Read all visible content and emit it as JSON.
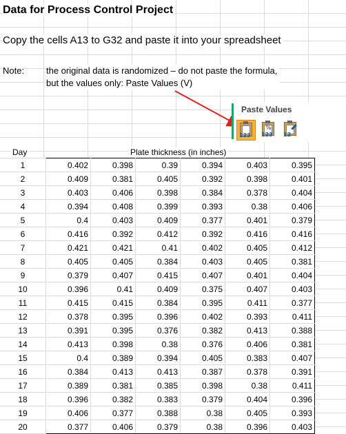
{
  "title": "Data for Process Control Project",
  "instruction": "Copy the cells A13 to G32 and paste it into your spreadsheet",
  "note": {
    "label": "Note:",
    "line1": "the original data is randomized – do not paste the formula,",
    "line2": "but the values only:  Paste Values (V)"
  },
  "paste_values": {
    "title": "Paste Values",
    "options": [
      {
        "icon": "paste-values-123-icon",
        "label": "123",
        "selected": true
      },
      {
        "icon": "paste-values-number-format-icon",
        "label": "123"
      },
      {
        "icon": "paste-values-source-formatting-icon",
        "label": "12"
      }
    ]
  },
  "colors": {
    "arrow": "#e02020",
    "selection": "#f3b43c",
    "accent": "#21a366"
  },
  "table": {
    "day_header": "Day",
    "value_header": "Plate thickness (in inches)",
    "rows": [
      {
        "day": "1",
        "values": [
          "0.402",
          "0.398",
          "0.39",
          "0.394",
          "0.403",
          "0.395"
        ]
      },
      {
        "day": "2",
        "values": [
          "0.409",
          "0.381",
          "0.405",
          "0.392",
          "0.398",
          "0.401"
        ]
      },
      {
        "day": "3",
        "values": [
          "0.403",
          "0.406",
          "0.398",
          "0.384",
          "0.378",
          "0.404"
        ]
      },
      {
        "day": "4",
        "values": [
          "0.394",
          "0.408",
          "0.399",
          "0.393",
          "0.38",
          "0.406"
        ]
      },
      {
        "day": "5",
        "values": [
          "0.4",
          "0.403",
          "0.409",
          "0.377",
          "0.401",
          "0.379"
        ]
      },
      {
        "day": "6",
        "values": [
          "0.416",
          "0.392",
          "0.412",
          "0.392",
          "0.416",
          "0.416"
        ]
      },
      {
        "day": "7",
        "values": [
          "0.421",
          "0.421",
          "0.41",
          "0.402",
          "0.405",
          "0.412"
        ]
      },
      {
        "day": "8",
        "values": [
          "0.405",
          "0.405",
          "0.384",
          "0.403",
          "0.405",
          "0.381"
        ]
      },
      {
        "day": "9",
        "values": [
          "0.379",
          "0.407",
          "0.415",
          "0.407",
          "0.401",
          "0.404"
        ]
      },
      {
        "day": "10",
        "values": [
          "0.396",
          "0.41",
          "0.409",
          "0.375",
          "0.407",
          "0.403"
        ]
      },
      {
        "day": "11",
        "values": [
          "0.415",
          "0.415",
          "0.384",
          "0.395",
          "0.411",
          "0.377"
        ]
      },
      {
        "day": "12",
        "values": [
          "0.378",
          "0.395",
          "0.396",
          "0.402",
          "0.393",
          "0.411"
        ]
      },
      {
        "day": "13",
        "values": [
          "0.391",
          "0.395",
          "0.376",
          "0.382",
          "0.413",
          "0.388"
        ]
      },
      {
        "day": "14",
        "values": [
          "0.413",
          "0.398",
          "0.38",
          "0.376",
          "0.406",
          "0.381"
        ]
      },
      {
        "day": "15",
        "values": [
          "0.4",
          "0.389",
          "0.394",
          "0.405",
          "0.383",
          "0.407"
        ]
      },
      {
        "day": "16",
        "values": [
          "0.384",
          "0.413",
          "0.413",
          "0.387",
          "0.378",
          "0.391"
        ]
      },
      {
        "day": "17",
        "values": [
          "0.389",
          "0.381",
          "0.385",
          "0.398",
          "0.38",
          "0.411"
        ]
      },
      {
        "day": "18",
        "values": [
          "0.396",
          "0.382",
          "0.383",
          "0.379",
          "0.404",
          "0.396"
        ]
      },
      {
        "day": "19",
        "values": [
          "0.406",
          "0.377",
          "0.388",
          "0.38",
          "0.405",
          "0.393"
        ]
      },
      {
        "day": "20",
        "values": [
          "0.377",
          "0.406",
          "0.379",
          "0.38",
          "0.396",
          "0.403"
        ]
      }
    ]
  }
}
